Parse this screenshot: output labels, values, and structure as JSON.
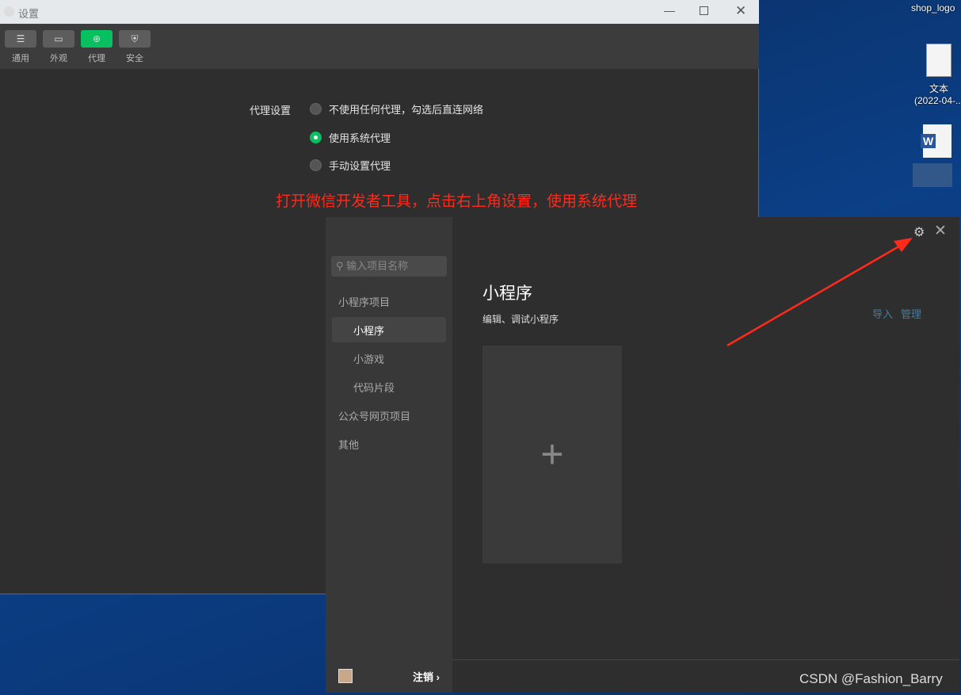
{
  "settings_window": {
    "title": "设置",
    "toolbar": [
      {
        "label": "通用",
        "icon": "sliders-icon"
      },
      {
        "label": "外观",
        "icon": "window-icon"
      },
      {
        "label": "代理",
        "icon": "globe-icon",
        "active": true
      },
      {
        "label": "安全",
        "icon": "shield-icon"
      }
    ],
    "proxy_label": "代理设置",
    "options": [
      {
        "label": "不使用任何代理，勾选后直连网络",
        "selected": false
      },
      {
        "label": "使用系统代理",
        "selected": true
      },
      {
        "label": "手动设置代理",
        "selected": false
      }
    ]
  },
  "annotation": "打开微信开发者工具，点击右上角设置，使用系统代理",
  "desktop": {
    "icons": [
      {
        "label": "shop_logo"
      },
      {
        "label": "文本",
        "sub": "(2022-04-..."
      },
      {
        "label": ""
      }
    ]
  },
  "devtools": {
    "search_placeholder": "输入项目名称",
    "nav": {
      "group1": "小程序项目",
      "items": [
        "小程序",
        "小游戏",
        "代码片段"
      ],
      "group2": "公众号网页项目",
      "group3": "其他"
    },
    "main": {
      "title": "小程序",
      "subtitle": "编辑、调试小程序",
      "import": "导入",
      "manage": "管理"
    },
    "logout": "注销"
  },
  "watermark": "CSDN @Fashion_Barry",
  "colors": {
    "accent": "#07c160",
    "annotation": "#ff2a1a"
  }
}
